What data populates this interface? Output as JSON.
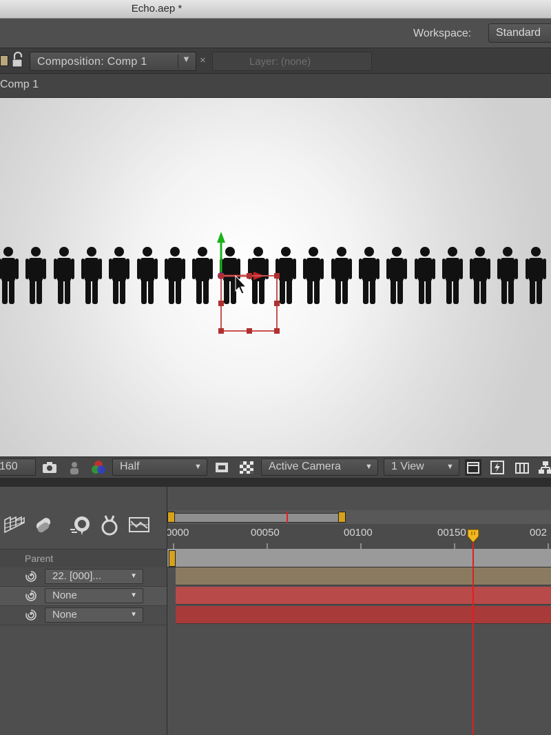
{
  "window": {
    "title": "Echo.aep *"
  },
  "workspace": {
    "label": "Workspace:",
    "value": "Standard"
  },
  "comp_panel": {
    "tab_label": "Composition: Comp 1",
    "tab_menu": "▼",
    "close_glyph": "×",
    "layer_tab_label": "Layer: (none)",
    "breadcrumb": "Comp 1"
  },
  "viewer": {
    "figure_count": 20,
    "figure_color": "#111111"
  },
  "viewer_toolbar": {
    "frame_field": "160",
    "resolution": "Half",
    "camera": "Active Camera",
    "views": "1 View",
    "caret": "▼"
  },
  "timeline": {
    "parent_header": "Parent",
    "layers": [
      {
        "parent": "22. [000]...",
        "bar_color": "#8a7a60"
      },
      {
        "parent": "None",
        "bar_color": "#b94a4a"
      },
      {
        "parent": "None",
        "bar_color": "#a83a3a"
      }
    ],
    "ruler_labels": [
      "0000",
      "00050",
      "00100",
      "00150",
      "002"
    ],
    "accent": "#e02020",
    "cti_color": "#f2b81e"
  },
  "icons": [
    "lock-icon",
    "snapshot-icon",
    "channel-icon",
    "transparency-grid-icon",
    "fast-preview-icon",
    "graph-editor-icon"
  ]
}
